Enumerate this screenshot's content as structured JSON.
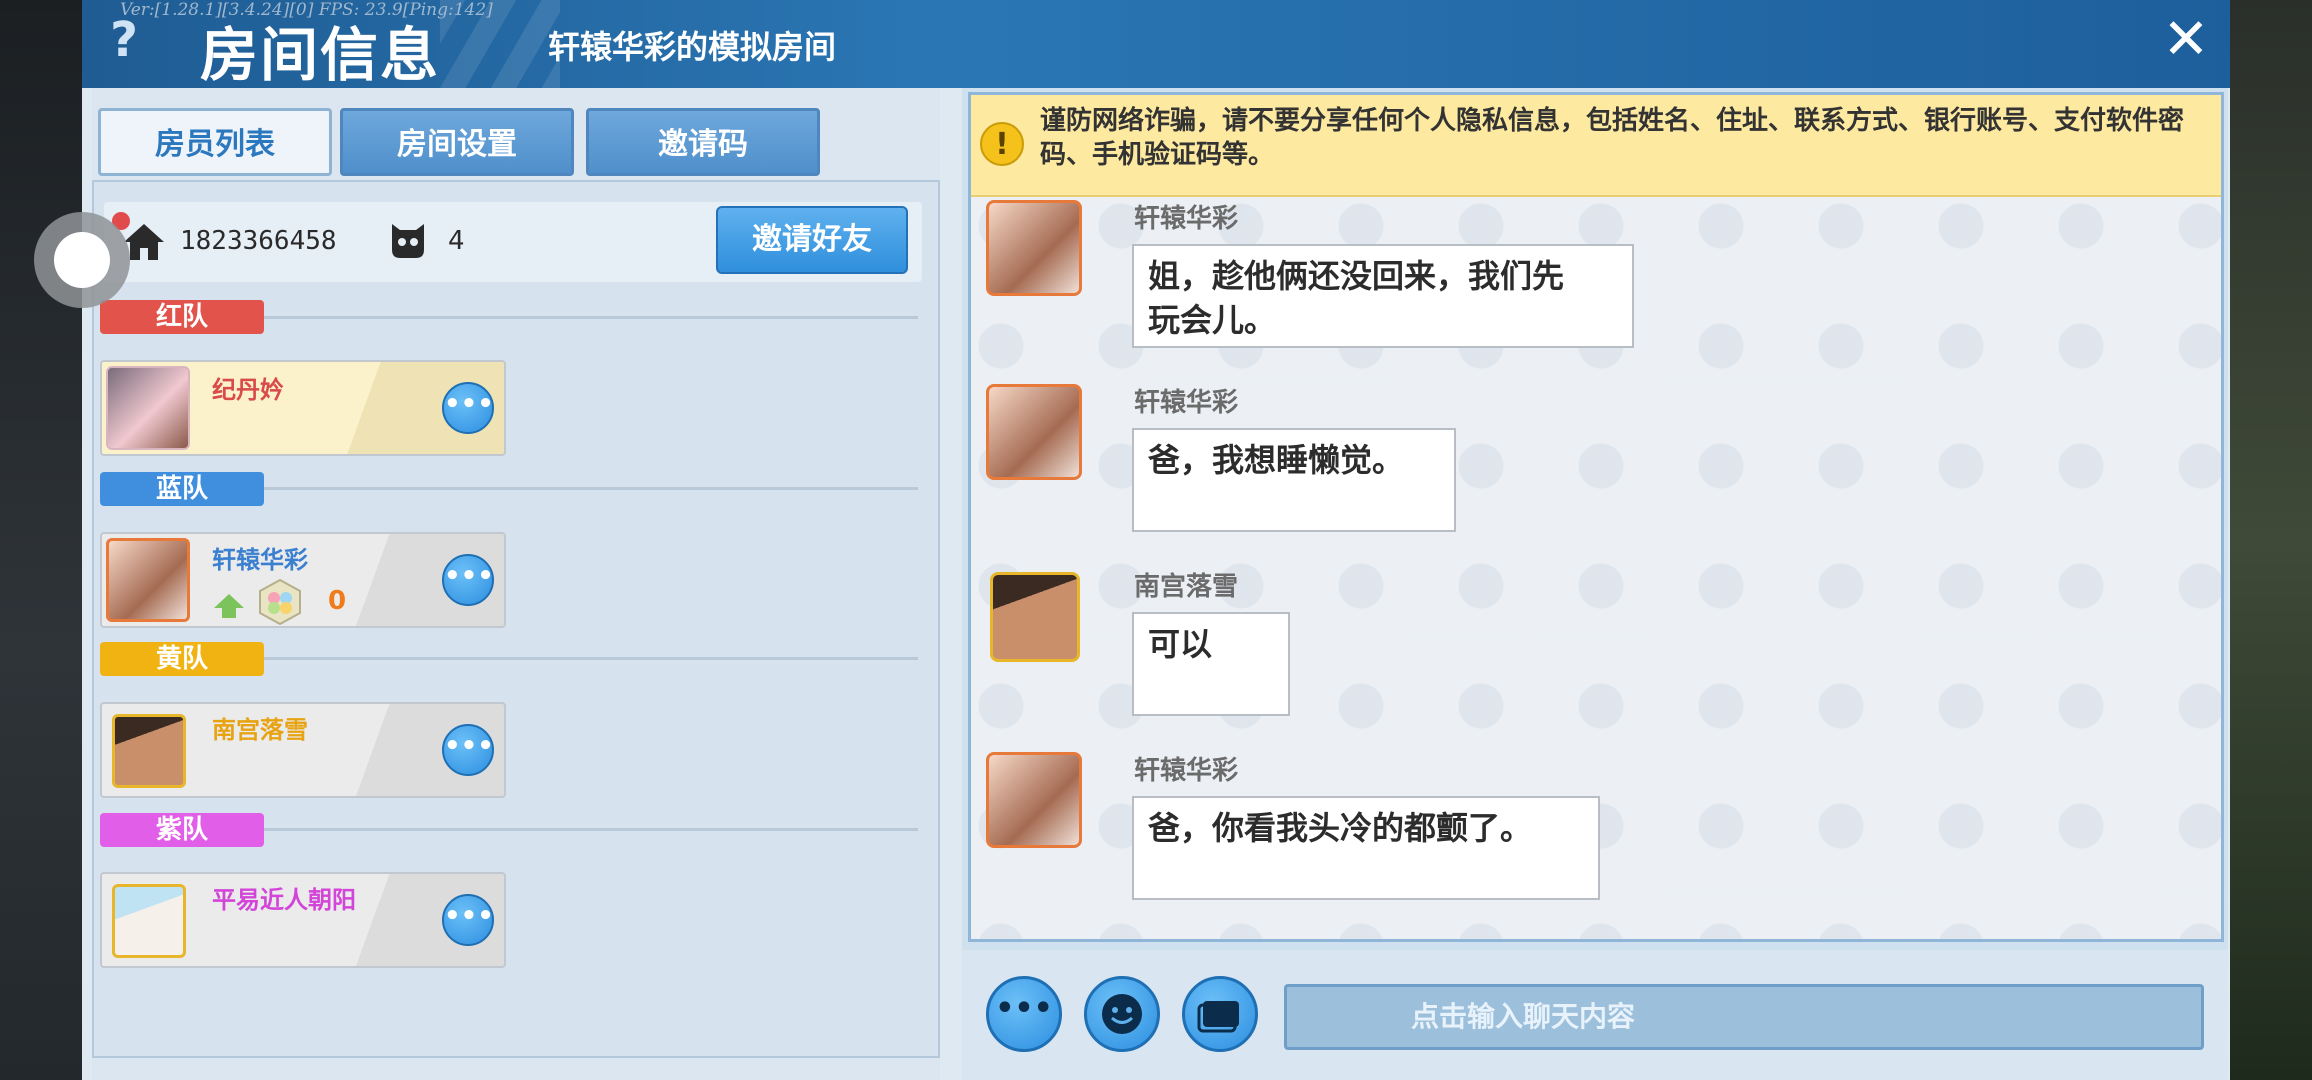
{
  "header": {
    "version": "Ver:[1.28.1][3.4.24][0] FPS: 23.9[Ping:142]",
    "help_label": "?",
    "title": "房间信息",
    "subtitle": "轩辕华彩的模拟房间",
    "close_label": "✕"
  },
  "tabs": [
    {
      "label": "房员列表",
      "active": true
    },
    {
      "label": "房间设置",
      "active": false
    },
    {
      "label": "邀请码",
      "active": false
    }
  ],
  "room": {
    "room_id": "1823366458",
    "player_count": "4",
    "invite_label": "邀请好友"
  },
  "teams": [
    {
      "name": "红队",
      "color": "#e2534b",
      "members": [
        {
          "name": "纪丹妗",
          "name_color": "#d94a4a",
          "extra": ""
        }
      ]
    },
    {
      "name": "蓝队",
      "color": "#3f8fde",
      "members": [
        {
          "name": "轩辕华彩",
          "name_color": "#3a7fd0",
          "extra": "0"
        }
      ]
    },
    {
      "name": "黄队",
      "color": "#f0b312",
      "members": [
        {
          "name": "南宫落雪",
          "name_color": "#e8a313",
          "extra": ""
        }
      ]
    },
    {
      "name": "紫队",
      "color": "#e05ee8",
      "members": [
        {
          "name": "平易近人朝阳",
          "name_color": "#d245d8",
          "extra": ""
        }
      ]
    }
  ],
  "more_label": "•••",
  "chat": {
    "warning": "谨防网络诈骗，请不要分享任何个人隐私信息，包括姓名、住址、联系方式、银行账号、支付软件密码、手机验证码等。",
    "warning_icon": "!",
    "messages": [
      {
        "sender": "轩辕华彩",
        "text_lines": [
          "姐，趁他俩还没回来，我们先",
          "玩会儿。"
        ]
      },
      {
        "sender": "轩辕华彩",
        "text_lines": [
          "爸，我想睡懒觉。"
        ]
      },
      {
        "sender": "南宫落雪",
        "text_lines": [
          "可以"
        ]
      },
      {
        "sender": "轩辕华彩",
        "text_lines": [
          "爸，你看我头冷的都颤了。"
        ]
      }
    ],
    "input_placeholder": "点击输入聊天内容"
  },
  "colors": {
    "title_bar": "#1f5c93",
    "accent_blue": "#2f8fdc",
    "warning_bg": "#fde9a0"
  }
}
